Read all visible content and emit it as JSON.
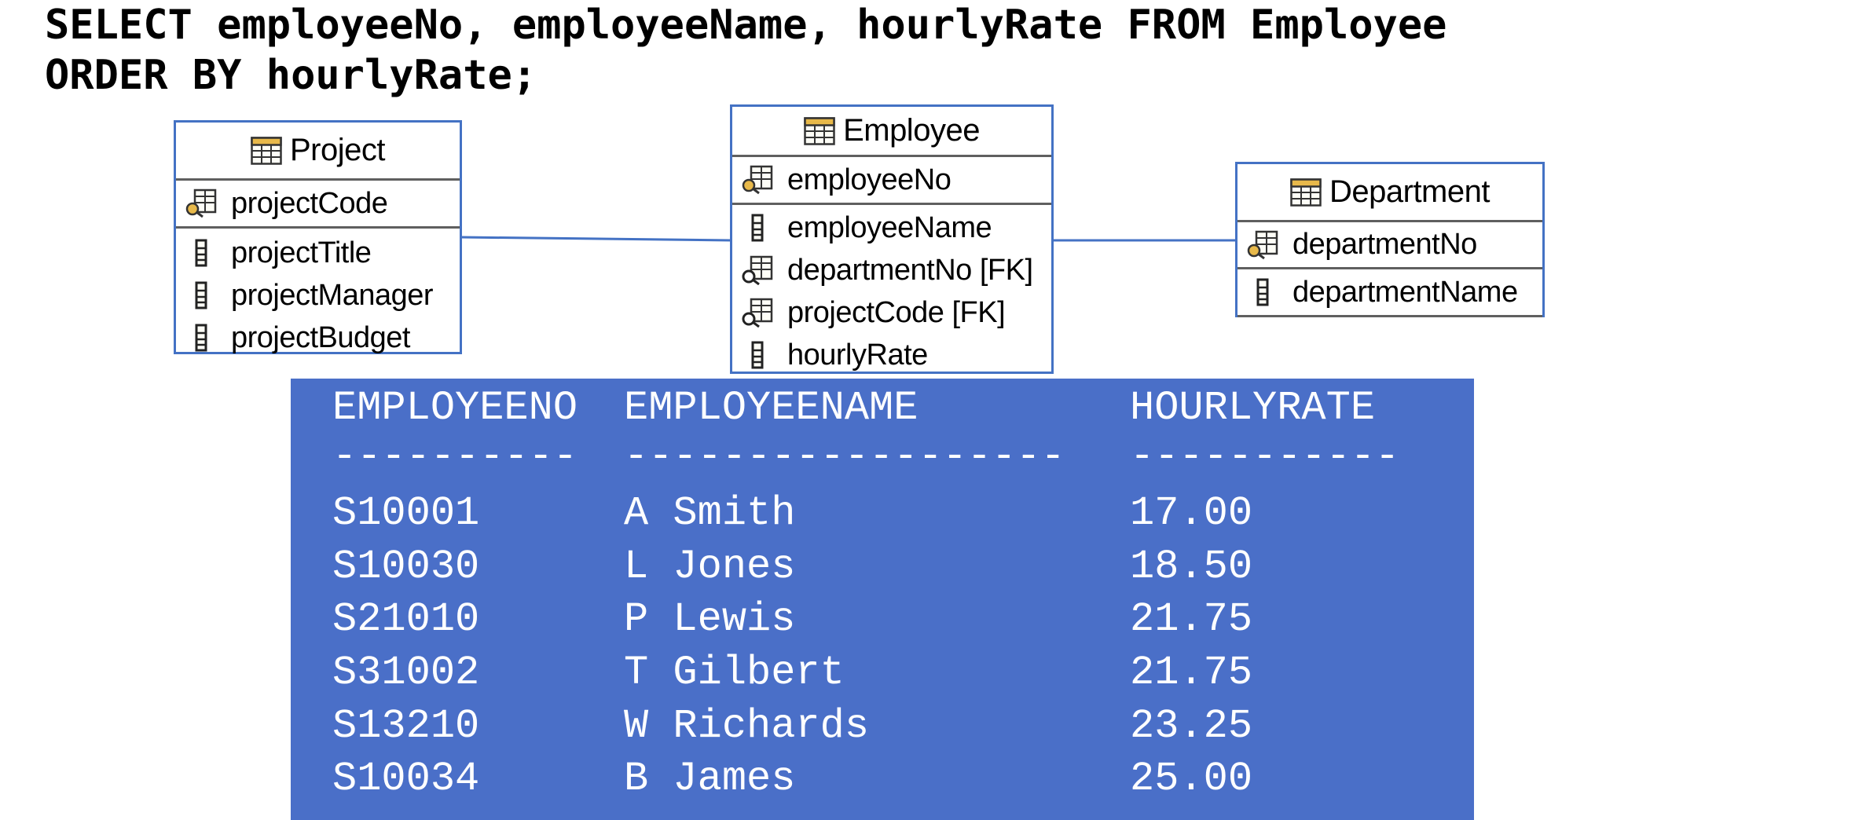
{
  "query": {
    "line1": "SELECT employeeNo, employeeName, hourlyRate FROM Employee",
    "line2": "ORDER BY hourlyRate;"
  },
  "diagram": {
    "entities": [
      {
        "name": "Project",
        "primary_key": "projectCode",
        "attributes": [
          "projectTitle",
          "projectManager",
          "projectBudget"
        ]
      },
      {
        "name": "Employee",
        "primary_key": "employeeNo",
        "attributes": [
          "employeeName",
          "departmentNo [FK]",
          "projectCode [FK]",
          "hourlyRate"
        ]
      },
      {
        "name": "Department",
        "primary_key": "departmentNo",
        "attributes": [
          "departmentName"
        ]
      }
    ],
    "icons": {
      "table": "table-icon",
      "primary_key": "primary-key-icon",
      "foreign_key": "foreign-key-icon",
      "column": "column-icon"
    },
    "colors": {
      "entity_border": "#4472c4",
      "connector": "#4472c4",
      "result_background": "#4a6fc8",
      "result_text": "#ffffff"
    }
  },
  "result": {
    "headers": [
      "EMPLOYEENO",
      "EMPLOYEENAME",
      "HOURLYRATE"
    ],
    "separators": [
      "----------",
      "------------------",
      "-----------"
    ],
    "rows": [
      [
        "S10001",
        "A Smith",
        "17.00"
      ],
      [
        "S10030",
        "L Jones",
        "18.50"
      ],
      [
        "S21010",
        "P Lewis",
        "21.75"
      ],
      [
        "S31002",
        "T Gilbert",
        "21.75"
      ],
      [
        "S13210",
        "W Richards",
        "23.25"
      ],
      [
        "S10034",
        "B James",
        "25.00"
      ]
    ]
  }
}
